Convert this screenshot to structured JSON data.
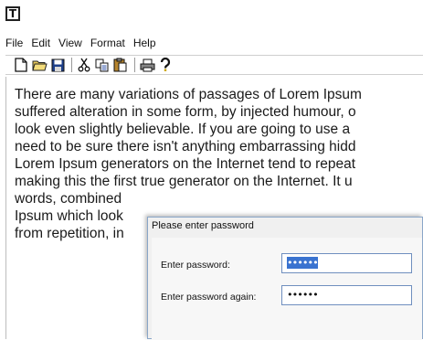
{
  "app": {
    "icon_glyph": "T"
  },
  "menu": [
    "File",
    "Edit",
    "View",
    "Format",
    "Help"
  ],
  "toolbar": {
    "icons": [
      "new-file-icon",
      "open-folder-icon",
      "save-icon",
      "cut-icon",
      "copy-icon",
      "paste-icon",
      "print-icon",
      "help-icon"
    ]
  },
  "document": {
    "lines": [
      "There are many variations of passages of Lorem Ipsum",
      "suffered alteration in some form, by injected humour, o",
      "look even slightly believable. If you are going to use a",
      "need to be sure there isn't anything embarrassing hidd",
      "Lorem Ipsum generators on the Internet tend to repeat",
      "making this the first true generator on the Internet. It u",
      "words, combined",
      "Ipsum which look",
      "from repetition, in"
    ]
  },
  "dialog": {
    "title": "Please enter password",
    "password_label": "Enter password:",
    "password_value": "••••••",
    "confirm_label": "Enter password again:",
    "confirm_value": "••••••"
  },
  "colors": {
    "selection": "#3a73d0",
    "dialog_border": "#8aa6c8"
  }
}
